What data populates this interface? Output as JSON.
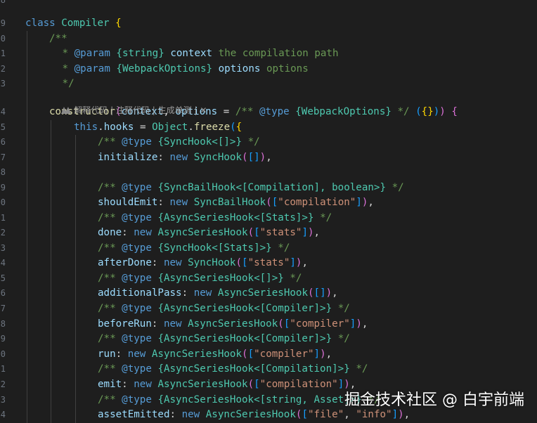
{
  "editor": {
    "line_numbers": [
      "8",
      "9",
      "0",
      "1",
      "2",
      "3",
      "",
      "4",
      "5",
      "6",
      "7",
      "8",
      "9",
      "0",
      "1",
      "2",
      "3",
      "4",
      "5",
      "6",
      "7",
      "8",
      "9",
      "0",
      "1",
      "2",
      "3",
      "4"
    ],
    "colors": {
      "background": "#1e1e1e",
      "keyword": "#569cd6",
      "class": "#4ec9b0",
      "function": "#dcdcaa",
      "property": "#9cdcfe",
      "string": "#ce9178",
      "comment": "#6a9955",
      "bracket_gold": "#ffd700",
      "bracket_purple": "#da70d6",
      "bracket_blue": "#179fff"
    },
    "lines": [
      {
        "parts": [
          {
            "t": "class ",
            "c": "kw"
          },
          {
            "t": "Compiler",
            "c": "cls"
          },
          {
            "t": " ",
            "c": "plain"
          },
          {
            "t": "{",
            "c": "br"
          }
        ]
      },
      {
        "parts": [
          {
            "t": "/**",
            "c": "cm"
          }
        ]
      },
      {
        "parts": [
          {
            "t": " * ",
            "c": "cm"
          },
          {
            "t": "@param",
            "c": "cmtag"
          },
          {
            "t": " ",
            "c": "cm"
          },
          {
            "t": "{string}",
            "c": "cmtype"
          },
          {
            "t": " ",
            "c": "cm"
          },
          {
            "t": "context",
            "c": "cmname"
          },
          {
            "t": " the compilation path",
            "c": "cm"
          }
        ]
      },
      {
        "parts": [
          {
            "t": " * ",
            "c": "cm"
          },
          {
            "t": "@param",
            "c": "cmtag"
          },
          {
            "t": " ",
            "c": "cm"
          },
          {
            "t": "{WebpackOptions}",
            "c": "cmtype"
          },
          {
            "t": " ",
            "c": "cm"
          },
          {
            "t": "options",
            "c": "cmname"
          },
          {
            "t": " options",
            "c": "cm"
          }
        ]
      },
      {
        "parts": [
          {
            "t": " */",
            "c": "cm"
          }
        ]
      },
      {
        "parts": [
          {
            "t": "constructor",
            "c": "fn"
          },
          {
            "t": "(",
            "c": "br2"
          },
          {
            "t": "context",
            "c": "prop"
          },
          {
            "t": ", ",
            "c": "plain"
          },
          {
            "t": "options",
            "c": "prop"
          },
          {
            "t": " = ",
            "c": "plain"
          },
          {
            "t": "/** ",
            "c": "cm"
          },
          {
            "t": "@type",
            "c": "cmtag"
          },
          {
            "t": " ",
            "c": "cm"
          },
          {
            "t": "{WebpackOptions}",
            "c": "cmtype"
          },
          {
            "t": " */ ",
            "c": "cm"
          },
          {
            "t": "(",
            "c": "br3"
          },
          {
            "t": "{}",
            "c": "br"
          },
          {
            "t": ")",
            "c": "br3"
          },
          {
            "t": ")",
            "c": "br2"
          },
          {
            "t": " ",
            "c": "plain"
          },
          {
            "t": "{",
            "c": "br2"
          }
        ]
      },
      {
        "parts": [
          {
            "t": "this",
            "c": "kw"
          },
          {
            "t": ".",
            "c": "plain"
          },
          {
            "t": "hooks",
            "c": "prop"
          },
          {
            "t": " = ",
            "c": "plain"
          },
          {
            "t": "Object",
            "c": "cls"
          },
          {
            "t": ".",
            "c": "plain"
          },
          {
            "t": "freeze",
            "c": "fn"
          },
          {
            "t": "(",
            "c": "br3"
          },
          {
            "t": "{",
            "c": "br"
          }
        ]
      },
      {
        "parts": [
          {
            "t": "/** ",
            "c": "cm"
          },
          {
            "t": "@type",
            "c": "cmtag"
          },
          {
            "t": " ",
            "c": "cm"
          },
          {
            "t": "{SyncHook<[]>}",
            "c": "cmtype"
          },
          {
            "t": " */",
            "c": "cm"
          }
        ]
      },
      {
        "parts": [
          {
            "t": "initialize",
            "c": "prop"
          },
          {
            "t": ": ",
            "c": "plain"
          },
          {
            "t": "new ",
            "c": "kw"
          },
          {
            "t": "SyncHook",
            "c": "cls"
          },
          {
            "t": "(",
            "c": "br2"
          },
          {
            "t": "[]",
            "c": "br3"
          },
          {
            "t": ")",
            "c": "br2"
          },
          {
            "t": ",",
            "c": "plain"
          }
        ]
      },
      {
        "parts": []
      },
      {
        "parts": [
          {
            "t": "/** ",
            "c": "cm"
          },
          {
            "t": "@type",
            "c": "cmtag"
          },
          {
            "t": " ",
            "c": "cm"
          },
          {
            "t": "{SyncBailHook<[Compilation], boolean>}",
            "c": "cmtype"
          },
          {
            "t": " */",
            "c": "cm"
          }
        ]
      },
      {
        "parts": [
          {
            "t": "shouldEmit",
            "c": "prop"
          },
          {
            "t": ": ",
            "c": "plain"
          },
          {
            "t": "new ",
            "c": "kw"
          },
          {
            "t": "SyncBailHook",
            "c": "cls"
          },
          {
            "t": "(",
            "c": "br2"
          },
          {
            "t": "[",
            "c": "br3"
          },
          {
            "t": "\"compilation\"",
            "c": "str"
          },
          {
            "t": "]",
            "c": "br3"
          },
          {
            "t": ")",
            "c": "br2"
          },
          {
            "t": ",",
            "c": "plain"
          }
        ]
      },
      {
        "parts": [
          {
            "t": "/** ",
            "c": "cm"
          },
          {
            "t": "@type",
            "c": "cmtag"
          },
          {
            "t": " ",
            "c": "cm"
          },
          {
            "t": "{AsyncSeriesHook<[Stats]>}",
            "c": "cmtype"
          },
          {
            "t": " */",
            "c": "cm"
          }
        ]
      },
      {
        "parts": [
          {
            "t": "done",
            "c": "prop"
          },
          {
            "t": ": ",
            "c": "plain"
          },
          {
            "t": "new ",
            "c": "kw"
          },
          {
            "t": "AsyncSeriesHook",
            "c": "cls"
          },
          {
            "t": "(",
            "c": "br2"
          },
          {
            "t": "[",
            "c": "br3"
          },
          {
            "t": "\"stats\"",
            "c": "str"
          },
          {
            "t": "]",
            "c": "br3"
          },
          {
            "t": ")",
            "c": "br2"
          },
          {
            "t": ",",
            "c": "plain"
          }
        ]
      },
      {
        "parts": [
          {
            "t": "/** ",
            "c": "cm"
          },
          {
            "t": "@type",
            "c": "cmtag"
          },
          {
            "t": " ",
            "c": "cm"
          },
          {
            "t": "{SyncHook<[Stats]>}",
            "c": "cmtype"
          },
          {
            "t": " */",
            "c": "cm"
          }
        ]
      },
      {
        "parts": [
          {
            "t": "afterDone",
            "c": "prop"
          },
          {
            "t": ": ",
            "c": "plain"
          },
          {
            "t": "new ",
            "c": "kw"
          },
          {
            "t": "SyncHook",
            "c": "cls"
          },
          {
            "t": "(",
            "c": "br2"
          },
          {
            "t": "[",
            "c": "br3"
          },
          {
            "t": "\"stats\"",
            "c": "str"
          },
          {
            "t": "]",
            "c": "br3"
          },
          {
            "t": ")",
            "c": "br2"
          },
          {
            "t": ",",
            "c": "plain"
          }
        ]
      },
      {
        "parts": [
          {
            "t": "/** ",
            "c": "cm"
          },
          {
            "t": "@type",
            "c": "cmtag"
          },
          {
            "t": " ",
            "c": "cm"
          },
          {
            "t": "{AsyncSeriesHook<[]>}",
            "c": "cmtype"
          },
          {
            "t": " */",
            "c": "cm"
          }
        ]
      },
      {
        "parts": [
          {
            "t": "additionalPass",
            "c": "prop"
          },
          {
            "t": ": ",
            "c": "plain"
          },
          {
            "t": "new ",
            "c": "kw"
          },
          {
            "t": "AsyncSeriesHook",
            "c": "cls"
          },
          {
            "t": "(",
            "c": "br2"
          },
          {
            "t": "[]",
            "c": "br3"
          },
          {
            "t": ")",
            "c": "br2"
          },
          {
            "t": ",",
            "c": "plain"
          }
        ]
      },
      {
        "parts": [
          {
            "t": "/** ",
            "c": "cm"
          },
          {
            "t": "@type",
            "c": "cmtag"
          },
          {
            "t": " ",
            "c": "cm"
          },
          {
            "t": "{AsyncSeriesHook<[Compiler]>}",
            "c": "cmtype"
          },
          {
            "t": " */",
            "c": "cm"
          }
        ]
      },
      {
        "parts": [
          {
            "t": "beforeRun",
            "c": "prop"
          },
          {
            "t": ": ",
            "c": "plain"
          },
          {
            "t": "new ",
            "c": "kw"
          },
          {
            "t": "AsyncSeriesHook",
            "c": "cls"
          },
          {
            "t": "(",
            "c": "br2"
          },
          {
            "t": "[",
            "c": "br3"
          },
          {
            "t": "\"compiler\"",
            "c": "str"
          },
          {
            "t": "]",
            "c": "br3"
          },
          {
            "t": ")",
            "c": "br2"
          },
          {
            "t": ",",
            "c": "plain"
          }
        ]
      },
      {
        "parts": [
          {
            "t": "/** ",
            "c": "cm"
          },
          {
            "t": "@type",
            "c": "cmtag"
          },
          {
            "t": " ",
            "c": "cm"
          },
          {
            "t": "{AsyncSeriesHook<[Compiler]>}",
            "c": "cmtype"
          },
          {
            "t": " */",
            "c": "cm"
          }
        ]
      },
      {
        "parts": [
          {
            "t": "run",
            "c": "prop"
          },
          {
            "t": ": ",
            "c": "plain"
          },
          {
            "t": "new ",
            "c": "kw"
          },
          {
            "t": "AsyncSeriesHook",
            "c": "cls"
          },
          {
            "t": "(",
            "c": "br2"
          },
          {
            "t": "[",
            "c": "br3"
          },
          {
            "t": "\"compiler\"",
            "c": "str"
          },
          {
            "t": "]",
            "c": "br3"
          },
          {
            "t": ")",
            "c": "br2"
          },
          {
            "t": ",",
            "c": "plain"
          }
        ]
      },
      {
        "parts": [
          {
            "t": "/** ",
            "c": "cm"
          },
          {
            "t": "@type",
            "c": "cmtag"
          },
          {
            "t": " ",
            "c": "cm"
          },
          {
            "t": "{AsyncSeriesHook<[Compilation]>}",
            "c": "cmtype"
          },
          {
            "t": " */",
            "c": "cm"
          }
        ]
      },
      {
        "parts": [
          {
            "t": "emit",
            "c": "prop"
          },
          {
            "t": ": ",
            "c": "plain"
          },
          {
            "t": "new ",
            "c": "kw"
          },
          {
            "t": "AsyncSeriesHook",
            "c": "cls"
          },
          {
            "t": "(",
            "c": "br2"
          },
          {
            "t": "[",
            "c": "br3"
          },
          {
            "t": "\"compilation\"",
            "c": "str"
          },
          {
            "t": "]",
            "c": "br3"
          },
          {
            "t": ")",
            "c": "br2"
          },
          {
            "t": ",",
            "c": "plain"
          }
        ]
      },
      {
        "parts": [
          {
            "t": "/** ",
            "c": "cm"
          },
          {
            "t": "@type",
            "c": "cmtag"
          },
          {
            "t": " ",
            "c": "cm"
          },
          {
            "t": "{AsyncSeriesHook<[string, Asset]>}",
            "c": "cmtype"
          },
          {
            "t": " */",
            "c": "cm"
          }
        ]
      },
      {
        "parts": [
          {
            "t": "assetEmitted",
            "c": "prop"
          },
          {
            "t": ": ",
            "c": "plain"
          },
          {
            "t": "new ",
            "c": "kw"
          },
          {
            "t": "AsyncSeriesHook",
            "c": "cls"
          },
          {
            "t": "(",
            "c": "br2"
          },
          {
            "t": "[",
            "c": "br3"
          },
          {
            "t": "\"file\"",
            "c": "str"
          },
          {
            "t": ", ",
            "c": "plain"
          },
          {
            "t": "\"info\"",
            "c": "str"
          },
          {
            "t": "]",
            "c": "br3"
          },
          {
            "t": ")",
            "c": "br2"
          },
          {
            "t": ",",
            "c": "plain"
          }
        ]
      }
    ]
  },
  "codelens": {
    "icon": "codelens-logo-icon",
    "explain": "解释代码",
    "sep": " | ",
    "comment": "注释代码",
    "unittest": "生成单测",
    "close": "✕"
  },
  "watermark": {
    "text": "掘金技术社区 @ 白宇前端"
  }
}
